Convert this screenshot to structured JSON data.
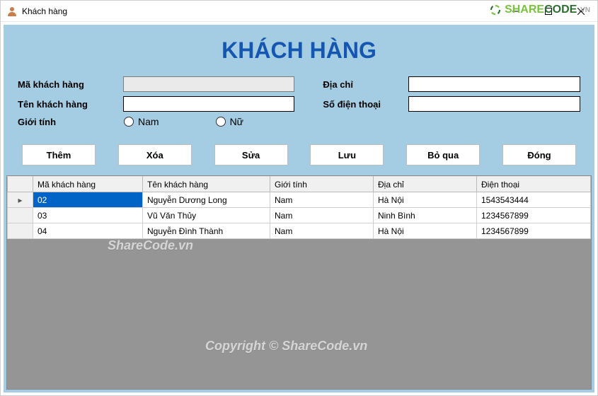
{
  "window": {
    "title": "Khách hàng"
  },
  "logo": {
    "text1": "SHARE",
    "text2": "CODE",
    "suffix": ".VN"
  },
  "page_title": "KHÁCH HÀNG",
  "form": {
    "id_label": "Mã khách hàng",
    "id_value": "",
    "name_label": "Tên khách hàng",
    "name_value": "",
    "gender_label": "Giới tính",
    "gender_male": "Nam",
    "gender_female": "Nữ",
    "address_label": "Địa chỉ",
    "address_value": "",
    "phone_label": "Số điện thoại",
    "phone_value": ""
  },
  "buttons": {
    "add": "Thêm",
    "delete": "Xóa",
    "edit": "Sửa",
    "save": "Lưu",
    "skip": "Bỏ qua",
    "close": "Đóng"
  },
  "grid": {
    "headers": {
      "id": "Mã khách hàng",
      "name": "Tên khách hàng",
      "gender": "Giới tính",
      "address": "Địa chỉ",
      "phone": "Điện thoại"
    },
    "rows": [
      {
        "id": "02",
        "name": "Nguyễn Dương Long",
        "gender": "Nam",
        "address": "Hà Nội",
        "phone": "1543543444"
      },
      {
        "id": "03",
        "name": "Vũ Văn Thủy",
        "gender": "Nam",
        "address": "Ninh Bình",
        "phone": "1234567899"
      },
      {
        "id": "04",
        "name": "Nguyễn Đình Thành",
        "gender": "Nam",
        "address": "Hà Nội",
        "phone": "1234567899"
      }
    ],
    "selected_index": 0
  },
  "watermark": {
    "a": "ShareCode.vn",
    "b": "Copyright © ShareCode.vn"
  }
}
